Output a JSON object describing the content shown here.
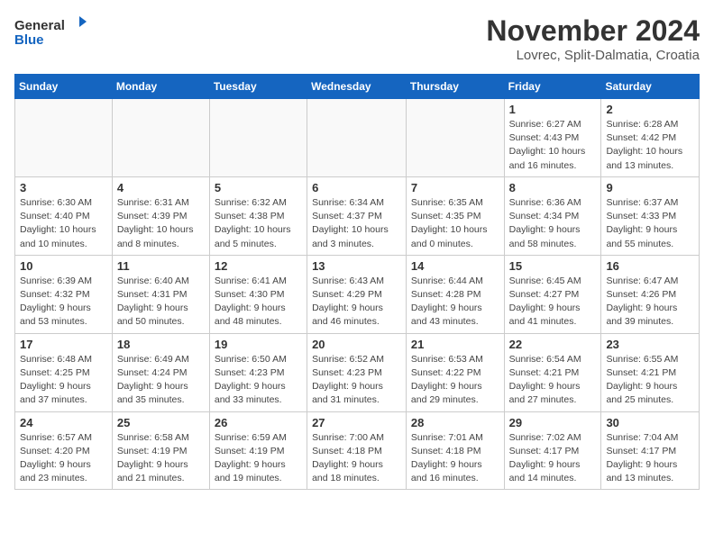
{
  "logo": {
    "text_general": "General",
    "text_blue": "Blue"
  },
  "title": "November 2024",
  "location": "Lovrec, Split-Dalmatia, Croatia",
  "weekdays": [
    "Sunday",
    "Monday",
    "Tuesday",
    "Wednesday",
    "Thursday",
    "Friday",
    "Saturday"
  ],
  "weeks": [
    [
      {
        "day": "",
        "info": ""
      },
      {
        "day": "",
        "info": ""
      },
      {
        "day": "",
        "info": ""
      },
      {
        "day": "",
        "info": ""
      },
      {
        "day": "",
        "info": ""
      },
      {
        "day": "1",
        "info": "Sunrise: 6:27 AM\nSunset: 4:43 PM\nDaylight: 10 hours and 16 minutes."
      },
      {
        "day": "2",
        "info": "Sunrise: 6:28 AM\nSunset: 4:42 PM\nDaylight: 10 hours and 13 minutes."
      }
    ],
    [
      {
        "day": "3",
        "info": "Sunrise: 6:30 AM\nSunset: 4:40 PM\nDaylight: 10 hours and 10 minutes."
      },
      {
        "day": "4",
        "info": "Sunrise: 6:31 AM\nSunset: 4:39 PM\nDaylight: 10 hours and 8 minutes."
      },
      {
        "day": "5",
        "info": "Sunrise: 6:32 AM\nSunset: 4:38 PM\nDaylight: 10 hours and 5 minutes."
      },
      {
        "day": "6",
        "info": "Sunrise: 6:34 AM\nSunset: 4:37 PM\nDaylight: 10 hours and 3 minutes."
      },
      {
        "day": "7",
        "info": "Sunrise: 6:35 AM\nSunset: 4:35 PM\nDaylight: 10 hours and 0 minutes."
      },
      {
        "day": "8",
        "info": "Sunrise: 6:36 AM\nSunset: 4:34 PM\nDaylight: 9 hours and 58 minutes."
      },
      {
        "day": "9",
        "info": "Sunrise: 6:37 AM\nSunset: 4:33 PM\nDaylight: 9 hours and 55 minutes."
      }
    ],
    [
      {
        "day": "10",
        "info": "Sunrise: 6:39 AM\nSunset: 4:32 PM\nDaylight: 9 hours and 53 minutes."
      },
      {
        "day": "11",
        "info": "Sunrise: 6:40 AM\nSunset: 4:31 PM\nDaylight: 9 hours and 50 minutes."
      },
      {
        "day": "12",
        "info": "Sunrise: 6:41 AM\nSunset: 4:30 PM\nDaylight: 9 hours and 48 minutes."
      },
      {
        "day": "13",
        "info": "Sunrise: 6:43 AM\nSunset: 4:29 PM\nDaylight: 9 hours and 46 minutes."
      },
      {
        "day": "14",
        "info": "Sunrise: 6:44 AM\nSunset: 4:28 PM\nDaylight: 9 hours and 43 minutes."
      },
      {
        "day": "15",
        "info": "Sunrise: 6:45 AM\nSunset: 4:27 PM\nDaylight: 9 hours and 41 minutes."
      },
      {
        "day": "16",
        "info": "Sunrise: 6:47 AM\nSunset: 4:26 PM\nDaylight: 9 hours and 39 minutes."
      }
    ],
    [
      {
        "day": "17",
        "info": "Sunrise: 6:48 AM\nSunset: 4:25 PM\nDaylight: 9 hours and 37 minutes."
      },
      {
        "day": "18",
        "info": "Sunrise: 6:49 AM\nSunset: 4:24 PM\nDaylight: 9 hours and 35 minutes."
      },
      {
        "day": "19",
        "info": "Sunrise: 6:50 AM\nSunset: 4:23 PM\nDaylight: 9 hours and 33 minutes."
      },
      {
        "day": "20",
        "info": "Sunrise: 6:52 AM\nSunset: 4:23 PM\nDaylight: 9 hours and 31 minutes."
      },
      {
        "day": "21",
        "info": "Sunrise: 6:53 AM\nSunset: 4:22 PM\nDaylight: 9 hours and 29 minutes."
      },
      {
        "day": "22",
        "info": "Sunrise: 6:54 AM\nSunset: 4:21 PM\nDaylight: 9 hours and 27 minutes."
      },
      {
        "day": "23",
        "info": "Sunrise: 6:55 AM\nSunset: 4:21 PM\nDaylight: 9 hours and 25 minutes."
      }
    ],
    [
      {
        "day": "24",
        "info": "Sunrise: 6:57 AM\nSunset: 4:20 PM\nDaylight: 9 hours and 23 minutes."
      },
      {
        "day": "25",
        "info": "Sunrise: 6:58 AM\nSunset: 4:19 PM\nDaylight: 9 hours and 21 minutes."
      },
      {
        "day": "26",
        "info": "Sunrise: 6:59 AM\nSunset: 4:19 PM\nDaylight: 9 hours and 19 minutes."
      },
      {
        "day": "27",
        "info": "Sunrise: 7:00 AM\nSunset: 4:18 PM\nDaylight: 9 hours and 18 minutes."
      },
      {
        "day": "28",
        "info": "Sunrise: 7:01 AM\nSunset: 4:18 PM\nDaylight: 9 hours and 16 minutes."
      },
      {
        "day": "29",
        "info": "Sunrise: 7:02 AM\nSunset: 4:17 PM\nDaylight: 9 hours and 14 minutes."
      },
      {
        "day": "30",
        "info": "Sunrise: 7:04 AM\nSunset: 4:17 PM\nDaylight: 9 hours and 13 minutes."
      }
    ]
  ]
}
